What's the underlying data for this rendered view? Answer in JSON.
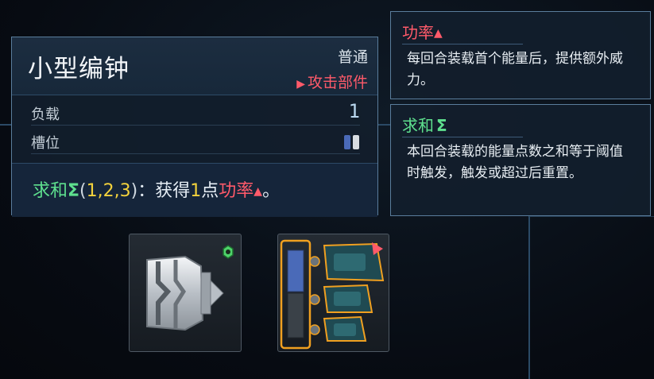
{
  "item": {
    "name": "小型编钟",
    "rarity": "普通",
    "type_label": "攻击部件",
    "stats": {
      "load_label": "负载",
      "load_value": "1",
      "slot_label": "槽位"
    },
    "effect": {
      "keyword": "求和",
      "sigma": "Σ",
      "open": "(",
      "v1": "1",
      "c1": ",",
      "v2": "2",
      "c2": ",",
      "v3": "3",
      "close": ")",
      "colon": "：",
      "gain": "获得",
      "amount": "1",
      "unit": "点",
      "power": "功率",
      "end": "。"
    }
  },
  "tooltips": [
    {
      "title": "功率",
      "body": "每回合装载首个能量后，提供额外威力。"
    },
    {
      "title": "求和",
      "sigma": "Σ",
      "body": "本回合装载的能量点数之和等于阈值时触发，触发或超过后重置。"
    }
  ],
  "colors": {
    "accent_red": "#ff5a6a",
    "accent_green": "#5ee08e",
    "accent_yellow": "#f3d23c",
    "panel_border": "#5a7d9c",
    "slot_blue": "#4a6ab8",
    "slot_white": "#d8dde2",
    "selection_orange": "#f0a020"
  },
  "icons": [
    "bell-item-icon",
    "weapon-module-icon",
    "green-hex-badge-icon",
    "red-corner-arrow-icon",
    "power-crown-icon"
  ]
}
